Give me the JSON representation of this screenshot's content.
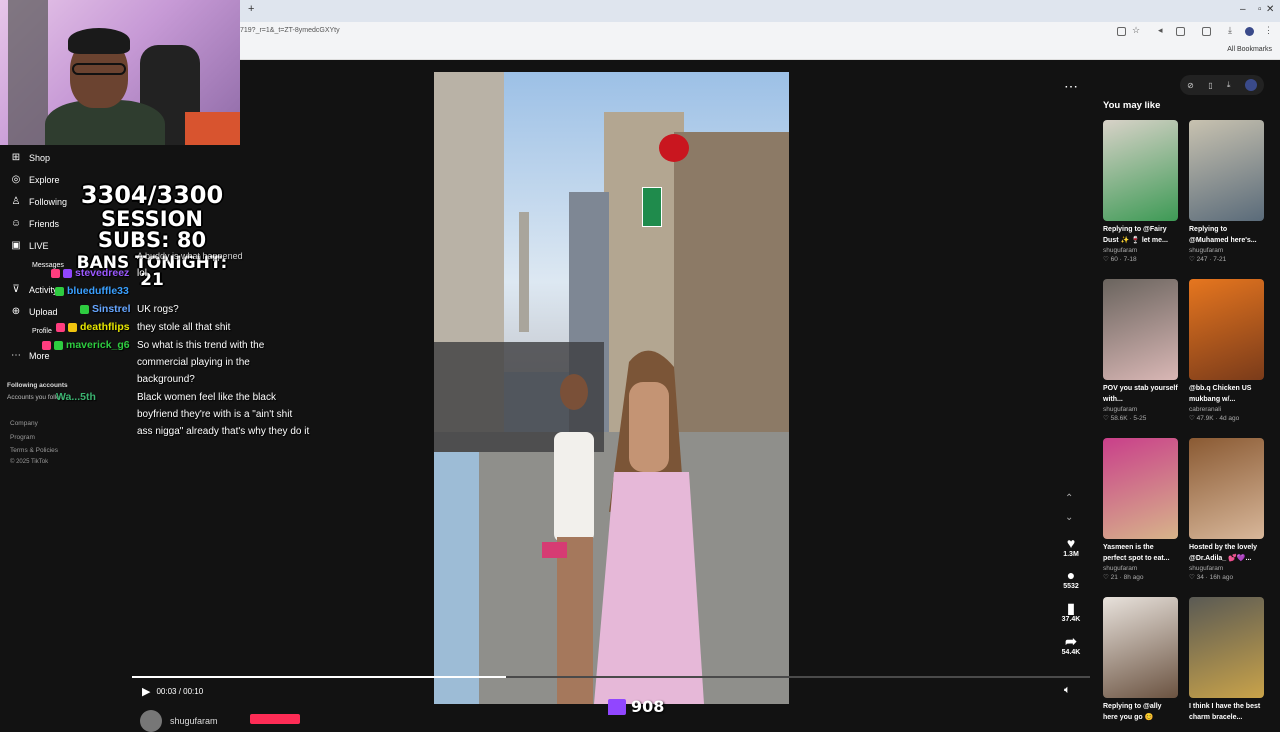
{
  "browser": {
    "url": "719?_r=1&_t=ZT-8ymedcGXYty",
    "all_bookmarks": "All Bookmarks",
    "new_tab": "+"
  },
  "sidebar": {
    "items": [
      {
        "label": "Shop",
        "icon": "shop-icon"
      },
      {
        "label": "Explore",
        "icon": "explore-icon"
      },
      {
        "label": "Following",
        "icon": "following-icon"
      },
      {
        "label": "Friends",
        "icon": "friends-icon"
      },
      {
        "label": "LIVE",
        "icon": "live-icon"
      },
      {
        "label": "Messages",
        "icon": "messages-icon"
      },
      {
        "label": "Activity",
        "icon": "activity-icon"
      },
      {
        "label": "Upload",
        "icon": "upload-icon"
      },
      {
        "label": "Profile",
        "icon": "profile-icon"
      },
      {
        "label": "More",
        "icon": "more-icon"
      }
    ],
    "following_accounts": "Following accounts",
    "following_sub": "Accounts you follow",
    "links": [
      "Company",
      "Program",
      "Terms & Policies",
      "© 2025 TikTok"
    ]
  },
  "overlay": {
    "goal": "3304/3300",
    "session_subs": "SESSION SUBS: 80",
    "bans": "BANS TONIGHT: 21",
    "viewers": "908"
  },
  "chat": {
    "rows": [
      {
        "user": "stevedreez",
        "color": "#9b59ff",
        "text": "lol"
      },
      {
        "user": "blueduffle33",
        "color": "#3aa0ff",
        "text": ""
      },
      {
        "user": "Sinstrel",
        "color": "#66a6ff",
        "text": "UK rogs?"
      },
      {
        "user": "deathflips",
        "color": "#e6e600",
        "text": "they stole all that shit"
      },
      {
        "user": "maverick_g6",
        "color": "#2ecc40",
        "text": "So what is this trend with the commercial playing in the background?"
      },
      {
        "user": "Wa...5th",
        "color": "#3cb371",
        "text": "Black women feel like the black boyfriend they're with is a \"ain't shit ass nigga\" already that's why they do it"
      }
    ],
    "partial_top": "A buddy is what happened",
    "lines": [
      "lol",
      "UK rogs?",
      "they stole all that shit",
      "So what is this trend with the",
      "commercial playing in the",
      "background?",
      "Black women feel like the black",
      "boyfriend they're with is a \"ain't shit",
      "ass nigga\" already that's why they do it"
    ]
  },
  "video": {
    "time": "00:03 / 00:10",
    "progress": 0.39,
    "author": "shugufaram",
    "actions": {
      "likes": "1.3M",
      "comments": "5532",
      "saves": "37.4K",
      "shares": "54.4K"
    }
  },
  "you_may_like": {
    "title": "You may like",
    "cards": [
      {
        "title": "Replying to @Fairy Dust ✨ 🍷 let me...",
        "author": "shugufaram",
        "meta": "♡ 60 · 7-18",
        "colors": [
          "#d8d2c8",
          "#3d9a55"
        ]
      },
      {
        "title": "Replying to @Muhamed here's...",
        "author": "shugufaram",
        "meta": "♡ 247 · 7-21",
        "colors": [
          "#c8c2b0",
          "#5a6b7a"
        ]
      },
      {
        "title": "POV you stab yourself with...",
        "author": "shugufaram",
        "meta": "♡ 58.6K · 5-25",
        "colors": [
          "#6a645e",
          "#d9b7b5"
        ]
      },
      {
        "title": "@bb.q Chicken US mukbang w/...",
        "author": "cabreranali",
        "meta": "♡ 47.9K · 4d ago",
        "colors": [
          "#e6761f",
          "#7a3b1a"
        ]
      },
      {
        "title": "Yasmeen is the perfect spot to eat...",
        "author": "shugufaram",
        "meta": "♡ 21 · 8h ago",
        "colors": [
          "#c93f8a",
          "#d7b48a"
        ]
      },
      {
        "title": "Hosted by the lovely @Dr.Adila_ 💕💜...",
        "author": "shugufaram",
        "meta": "♡ 34 · 16h ago",
        "colors": [
          "#8a5a33",
          "#d8b79a"
        ]
      },
      {
        "title": "Replying to @ally here you go 😊",
        "author": "",
        "meta": "",
        "colors": [
          "#e8e2dc",
          "#6b5341"
        ]
      },
      {
        "title": "I think I have the best charm bracele...",
        "author": "",
        "meta": "",
        "colors": [
          "#5a5a54",
          "#c9a34a"
        ]
      }
    ]
  }
}
